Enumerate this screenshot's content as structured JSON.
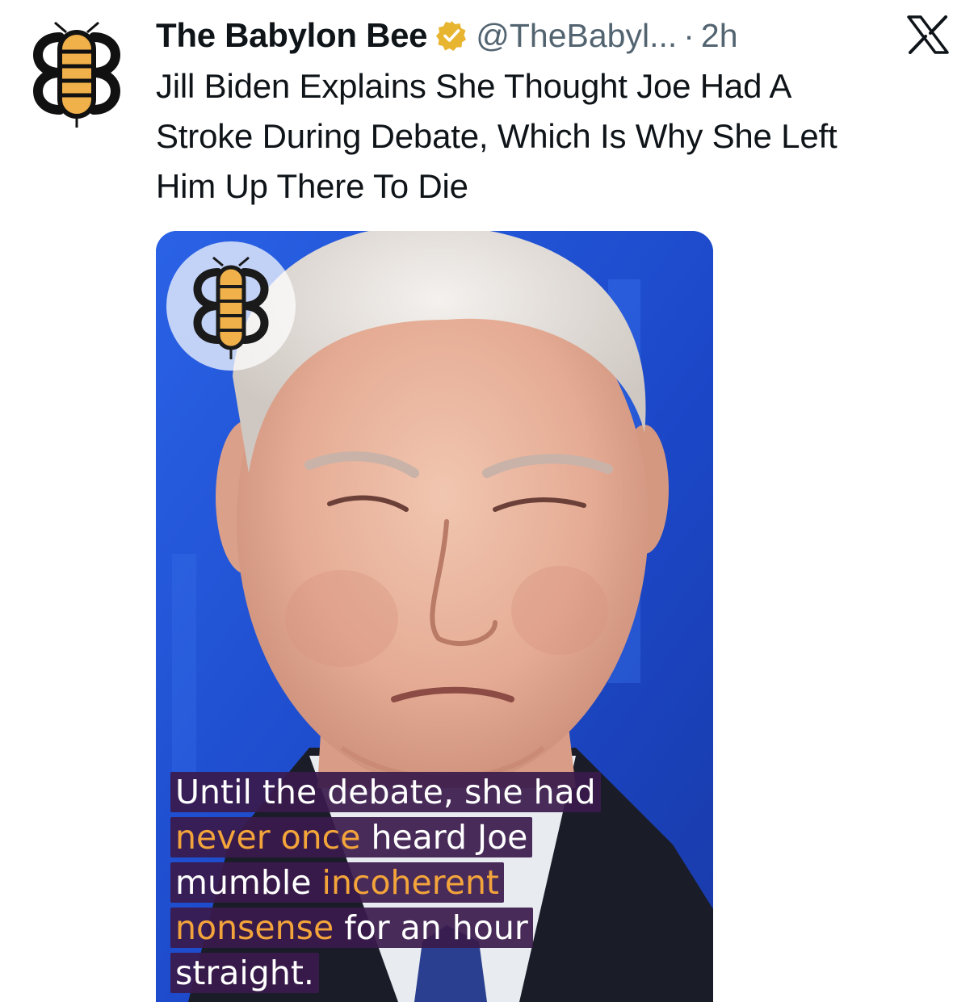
{
  "post": {
    "display_name": "The Babylon Bee",
    "verified_icon": "verified-badge-icon",
    "handle": "@TheBabyl...",
    "separator": "·",
    "time": "2h",
    "text_lines": [
      "Jill Biden Explains She Thought Joe Had A",
      "Stroke During Debate, Which Is Why She Left",
      "Him Up There To Die"
    ]
  },
  "icons": {
    "avatar": "babylon-bee-logo-icon",
    "platform": "x-logo-icon",
    "media_watermark": "babylon-bee-logo-icon"
  },
  "media": {
    "caption": {
      "line1": {
        "a": "Until the debate, she had"
      },
      "line2": {
        "a": "never once",
        "b": " heard Joe"
      },
      "line3": {
        "a": "mumble ",
        "b": "incoherent"
      },
      "line4": {
        "a": "nonsense",
        "b": " for an hour"
      },
      "line5": {
        "a": "straight."
      }
    }
  },
  "colors": {
    "brand_yellow": "#f0b04a",
    "highlight_orange": "#f3a43a",
    "caption_bg": "#3a1a4c",
    "verified_gold": "#e8b531",
    "muted_text": "#536471",
    "stage_blue": "#1e4fd0"
  }
}
